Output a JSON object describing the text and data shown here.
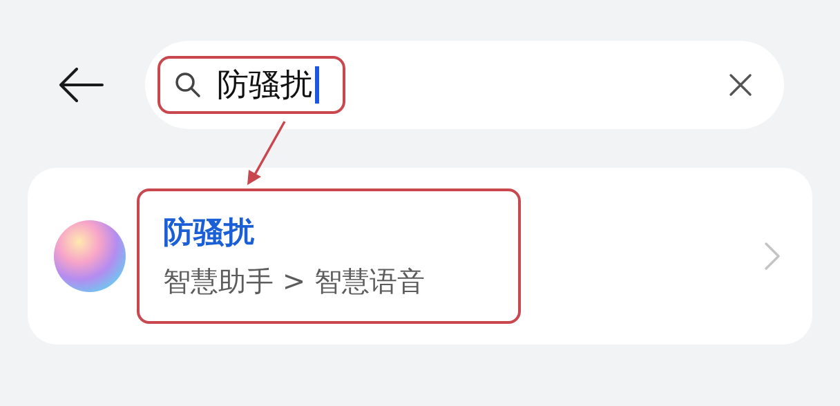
{
  "search": {
    "value": "防骚扰",
    "focused": true
  },
  "results": [
    {
      "title": "防骚扰",
      "path": "智慧助手 > 智慧语音"
    }
  ]
}
